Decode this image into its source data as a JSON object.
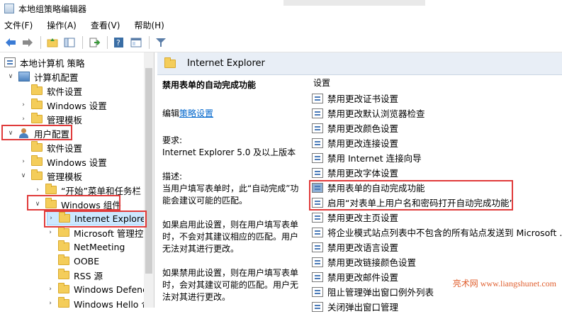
{
  "window": {
    "title": "本地组策略编辑器"
  },
  "menubar": [
    "文件(F)",
    "操作(A)",
    "查看(V)",
    "帮助(H)"
  ],
  "toolbar": {
    "icons": [
      "back-arrow-icon",
      "forward-arrow-icon",
      "up-folder-icon",
      "show-hide-tree-icon",
      "export-icon",
      "help-icon",
      "properties-icon",
      "filter-icon"
    ]
  },
  "tree": {
    "items": [
      {
        "label": "本地计算机 策略",
        "level": 0,
        "icon": "policy",
        "chevron": ""
      },
      {
        "label": "计算机配置",
        "level": 1,
        "icon": "computer",
        "chevron": "down"
      },
      {
        "label": "软件设置",
        "level": 2,
        "icon": "folder",
        "chevron": ""
      },
      {
        "label": "Windows 设置",
        "level": 2,
        "icon": "folder",
        "chevron": "right"
      },
      {
        "label": "管理模板",
        "level": 2,
        "icon": "folder",
        "chevron": "right"
      },
      {
        "label": "用户配置",
        "level": 1,
        "icon": "user",
        "chevron": "down"
      },
      {
        "label": "软件设置",
        "level": 2,
        "icon": "folder",
        "chevron": ""
      },
      {
        "label": "Windows 设置",
        "level": 2,
        "icon": "folder",
        "chevron": "right"
      },
      {
        "label": "管理模板",
        "level": 2,
        "icon": "folder",
        "chevron": "down"
      },
      {
        "label": "“开始”菜单和任务栏",
        "level": 3,
        "icon": "folder",
        "chevron": "right"
      },
      {
        "label": "Windows 组件",
        "level": 3,
        "icon": "folder",
        "chevron": "down"
      },
      {
        "label": "Internet Explorer",
        "level": 4,
        "icon": "folder",
        "chevron": "right"
      },
      {
        "label": "Microsoft 管理控",
        "level": 4,
        "icon": "folder",
        "chevron": "right"
      },
      {
        "label": "NetMeeting",
        "level": 4,
        "icon": "folder",
        "chevron": ""
      },
      {
        "label": "OOBE",
        "level": 4,
        "icon": "folder",
        "chevron": ""
      },
      {
        "label": "RSS 源",
        "level": 4,
        "icon": "folder",
        "chevron": ""
      },
      {
        "label": "Windows Defend",
        "level": 4,
        "icon": "folder",
        "chevron": "right"
      },
      {
        "label": "Windows Hello 企",
        "level": 4,
        "icon": "folder",
        "chevron": "right"
      }
    ]
  },
  "right": {
    "header_title": "Internet Explorer",
    "description": {
      "title": "禁用表单的自动完成功能",
      "edit_prefix": "编辑",
      "edit_link": "策略设置",
      "requirements_label": "要求:",
      "requirements_value": "Internet Explorer 5.0 及以上版本",
      "desc_label": "描述:",
      "desc_text": "当用户填写表单时，此“自动完成”功能会建议可能的匹配。",
      "enabled_text": "如果启用此设置，则在用户填写表单时，不会对其建议相应的匹配。用户无法对其进行更改。",
      "disabled_text": "如果禁用此设置，则在用户填写表单时，会对其建议可能的匹配。用户无法对其进行更改。"
    },
    "list_header": "设置",
    "list_items": [
      "禁用更改证书设置",
      "禁用更改默认浏览器检查",
      "禁用更改颜色设置",
      "禁用更改连接设置",
      "禁用 Internet 连接向导",
      "禁用更改字体设置",
      "禁用表单的自动完成功能",
      "启用“对表单上用户名和密码打开自动完成功能”",
      "禁用更改主页设置",
      "将企业模式站点列表中不包含的所有站点发送到 Microsoft ...",
      "禁用更改语言设置",
      "禁用更改链接颜色设置",
      "禁用更改邮件设置",
      "阻止管理弹出窗口例外列表",
      "关闭弹出窗口管理"
    ]
  },
  "watermark": "亮术网 www.liangshunet.com",
  "colors": {
    "highlight_border": "#e03b3b",
    "selection": "#cce8ff",
    "header_bg": "#e8eef6"
  }
}
